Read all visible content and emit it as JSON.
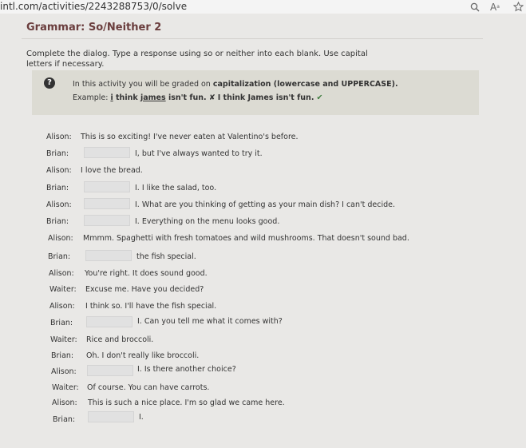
{
  "browser": {
    "url": "intl.com/activities/2243288753/0/solve",
    "search_icon": "search-icon",
    "reader_icon": "reader-mode-icon",
    "star_icon": "star-icon"
  },
  "page": {
    "title": "Grammar: So/Neither 2",
    "instructions": "Complete the dialog. Type a response using so or neither into each blank. Use capital letters if necessary."
  },
  "note": {
    "line1_prefix": "In this activity you will be graded on ",
    "line1_bold": "capitalization (lowercase and UPPERCASE).",
    "example_label": "Example: ",
    "example_wrong_prefix": "i",
    "example_wrong_rest": " think ",
    "example_wrong_name": "james",
    "example_wrong_tail": " isn't fun.",
    "x_mark": "✘",
    "example_right": "I think James isn't fun.",
    "check_mark": "✔"
  },
  "dialog": [
    {
      "speaker": "Alison:",
      "text": "This is so exciting! I've never eaten at Valentino's before.",
      "blank": false
    },
    {
      "speaker": "Brian:",
      "text": "I, but I've always wanted to try it.",
      "blank": true
    },
    {
      "speaker": "Alison:",
      "text": "I love the bread.",
      "blank": false
    },
    {
      "speaker": "Brian:",
      "text": "I. I like the salad, too.",
      "blank": true
    },
    {
      "speaker": "Alison:",
      "text": "I. What are you thinking of getting as your main dish? I can't decide.",
      "blank": true
    },
    {
      "speaker": "Brian:",
      "text": "I. Everything on the menu looks good.",
      "blank": true
    },
    {
      "speaker": "Alison:",
      "text": "Mmmm. Spaghetti with fresh tomatoes and wild mushrooms. That doesn't sound bad.",
      "blank": false
    },
    {
      "speaker": "Brian:",
      "text": "the fish special.",
      "blank": true
    },
    {
      "speaker": "Alison:",
      "text": "You're right. It does sound good.",
      "blank": false
    },
    {
      "speaker": "Waiter:",
      "text": "Excuse me. Have you decided?",
      "blank": false
    },
    {
      "speaker": "Alison:",
      "text": "I think so. I'll have the fish special.",
      "blank": false
    },
    {
      "speaker": "Brian:",
      "text": "I. Can you tell me what it comes with?",
      "blank": true
    },
    {
      "speaker": "Waiter:",
      "text": "Rice and broccoli.",
      "blank": false
    },
    {
      "speaker": "Brian:",
      "text": "Oh. I don't really like broccoli.",
      "blank": false
    },
    {
      "speaker": "Alison:",
      "text": "I. Is there another choice?",
      "blank": true
    },
    {
      "speaker": "Waiter:",
      "text": "Of course. You can have carrots.",
      "blank": false
    },
    {
      "speaker": "Alison:",
      "text": "This is such a nice place. I'm so glad we came here.",
      "blank": false
    },
    {
      "speaker": "Brian:",
      "text": "I.",
      "blank": true
    }
  ]
}
